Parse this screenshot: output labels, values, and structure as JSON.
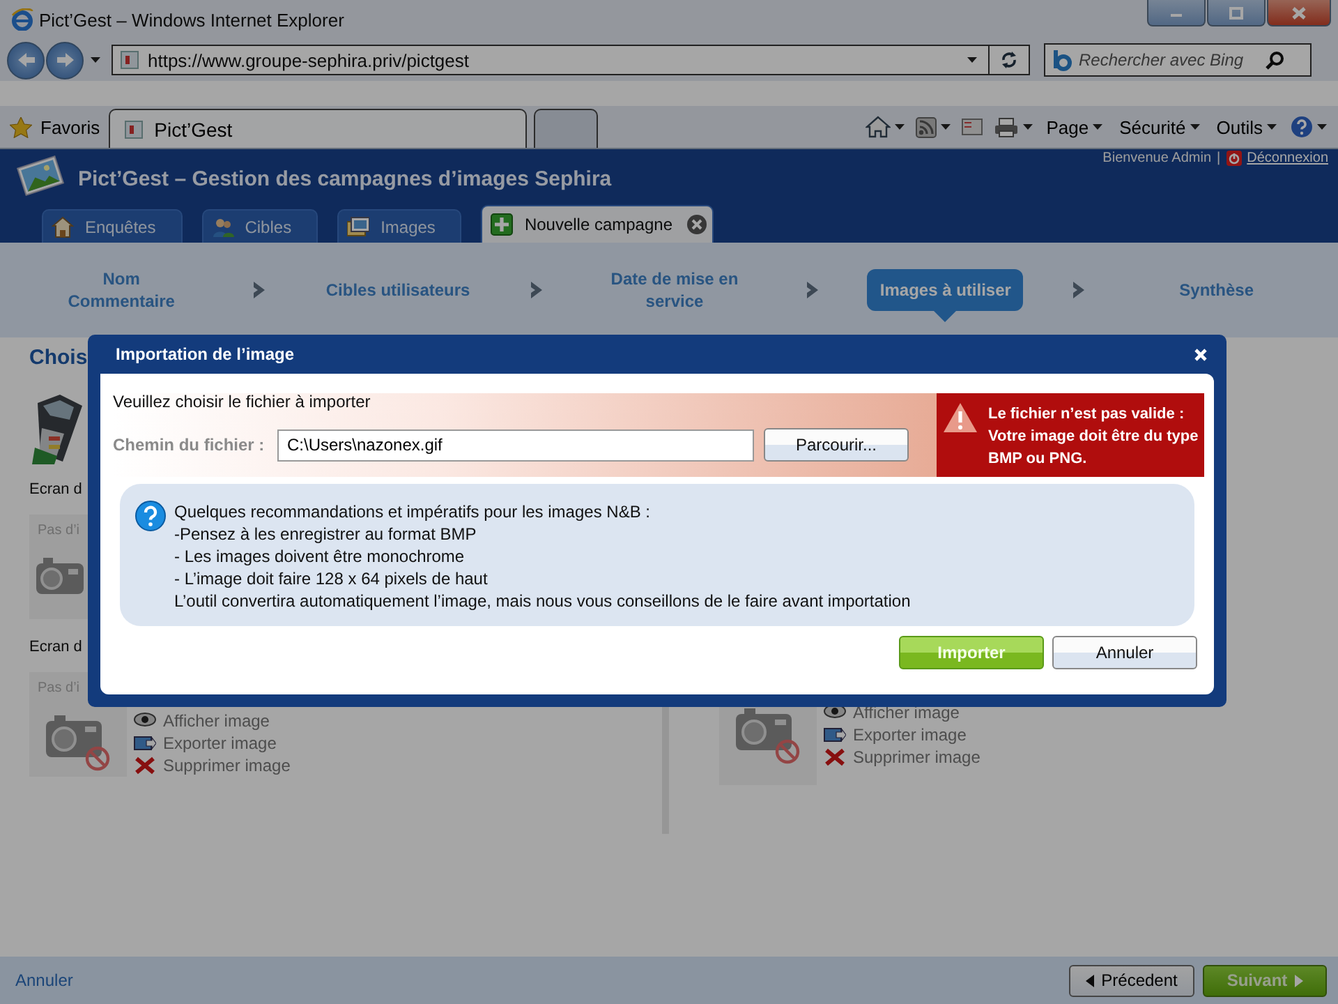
{
  "browser": {
    "title": "Pict’Gest – Windows Internet Explorer",
    "address": "https://www.groupe-sephira.priv/pictgest",
    "search_placeholder": "Rechercher avec Bing",
    "favorites": "Favoris",
    "tabs": [
      {
        "kind": "page",
        "label": "Pict’Gest",
        "selected": true
      },
      {
        "kind": "new",
        "selected": false
      }
    ],
    "menus": [
      "Page",
      "Sécurité",
      "Outils"
    ]
  },
  "app": {
    "title": "Pict’Gest – Gestion des campagnes d’images Sephira",
    "welcome": "Bienvenue Admin",
    "separator": "|",
    "logout": "Déconnexion",
    "tabs": [
      {
        "kind": "home",
        "label": "Enquêtes",
        "selected": false,
        "closable": false
      },
      {
        "kind": "users",
        "label": "Cibles",
        "selected": false,
        "closable": false
      },
      {
        "kind": "images",
        "label": "Images",
        "selected": false,
        "closable": false
      },
      {
        "kind": "add",
        "label": "Nouvelle campagne",
        "selected": true,
        "closable": true
      }
    ],
    "steps": [
      {
        "label": "Nom\nCommentaire",
        "selected": false
      },
      {
        "label": "Cibles utilisateurs",
        "selected": false
      },
      {
        "label": "Date de mise en\nservice",
        "selected": false
      },
      {
        "label": "Images à utiliser",
        "selected": true
      },
      {
        "label": "Synthèse",
        "selected": false
      }
    ],
    "content": {
      "heading": "Chois",
      "left": [
        {
          "kind": "picture"
        },
        {
          "kind": "caption",
          "text": "Ecran d"
        },
        {
          "kind": "placeholder",
          "text": "Pas d’i",
          "blocked": false
        },
        {
          "kind": "caption",
          "text": "Ecran d"
        },
        {
          "kind": "placeholder",
          "text": "Pas d’i",
          "blocked": true,
          "actions": [
            {
              "kind": "view",
              "label": "Afficher image"
            },
            {
              "kind": "export",
              "label": "Exporter image"
            },
            {
              "kind": "delete",
              "label": "Supprimer image"
            }
          ]
        }
      ],
      "right": [
        {
          "kind": "placeholder",
          "blocked": true,
          "actions": [
            {
              "kind": "view",
              "label": "Afficher image"
            },
            {
              "kind": "export",
              "label": "Exporter image"
            },
            {
              "kind": "delete",
              "label": "Supprimer image"
            }
          ]
        }
      ]
    },
    "footer": {
      "cancel": "Annuler",
      "previous": "Précedent",
      "next": "Suivant"
    }
  },
  "dialog": {
    "title": "Importation de l’image",
    "prompt": "Veuillez choisir le fichier à importer",
    "path_label": "Chemin du fichier :",
    "path_value": "C:\\Users\\nazonex.gif",
    "browse": "Parcourir...",
    "error": "Le fichier n’est pas valide :  Votre image doit être du type  BMP ou PNG.",
    "info": [
      "Quelques recommandations et impératifs pour les images N&B :",
      "-Pensez à les enregistrer au format BMP",
      "- Les images doivent être monochrome",
      "- L’image doit faire 128 x 64 pixels de haut",
      "L’outil convertira automatiquement  l’image, mais nous vous conseillons de le faire avant importation"
    ],
    "import": "Importer",
    "cancel": "Annuler"
  }
}
